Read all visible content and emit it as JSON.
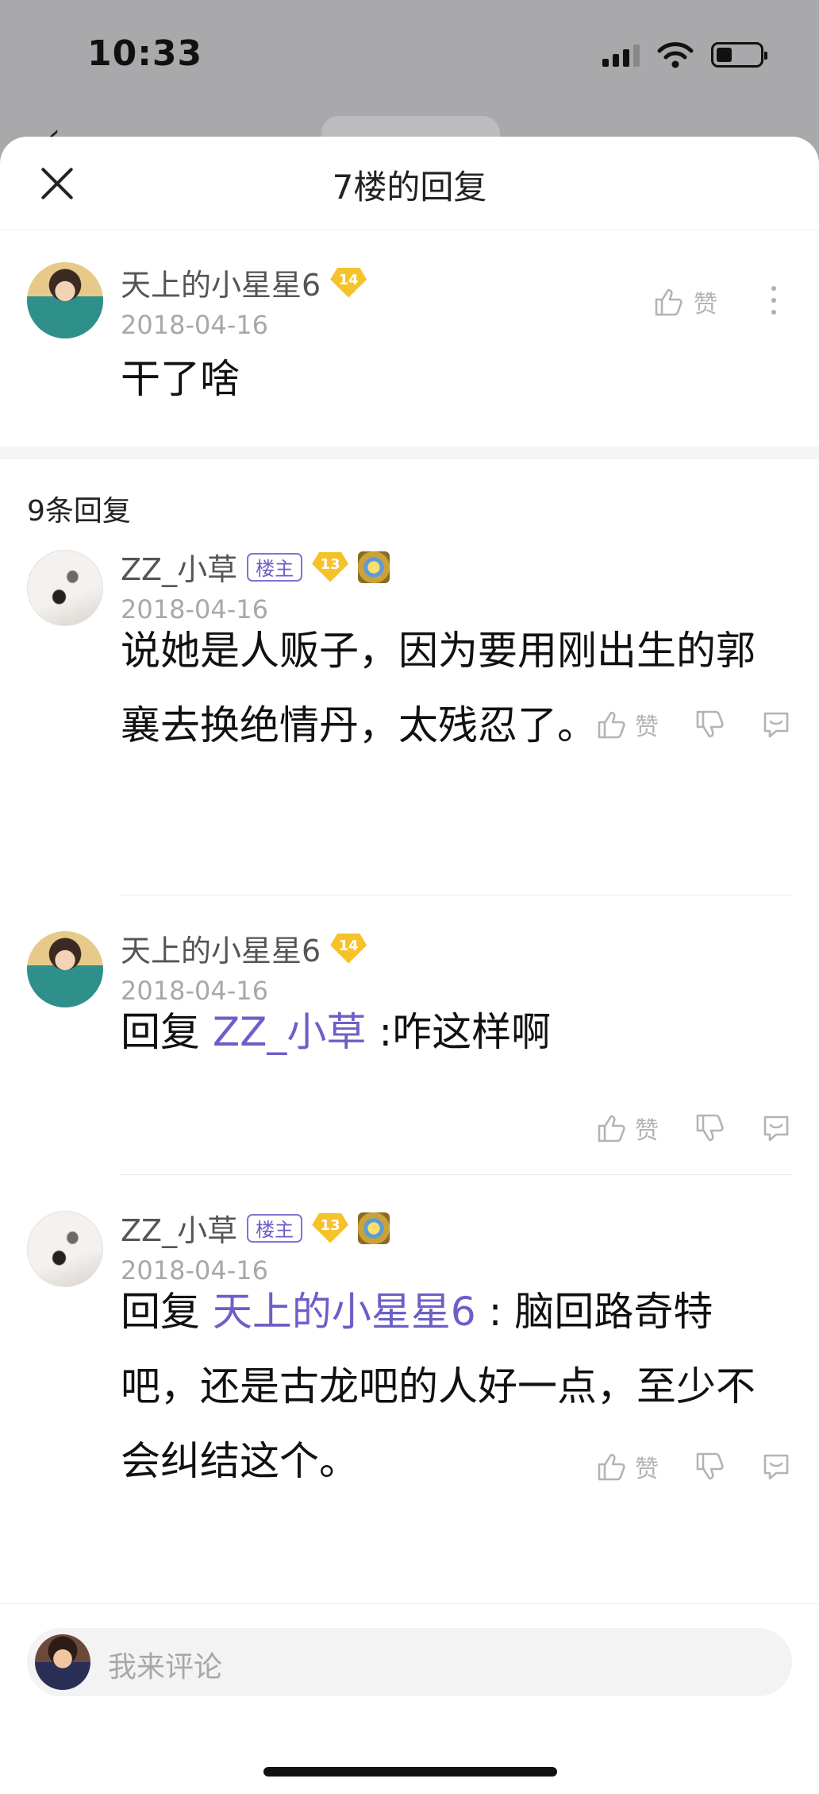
{
  "status_bar": {
    "time": "10:33"
  },
  "sheet": {
    "title": "7楼的回复"
  },
  "main_post": {
    "username": "天上的小星星6",
    "level": "14",
    "date": "2018-04-16",
    "like_label": "赞",
    "content": "干了啥"
  },
  "replies_header": "9条回复",
  "replies": [
    {
      "username": "ZZ_小草",
      "host_badge": "楼主",
      "level": "13",
      "date": "2018-04-16",
      "content": "说她是人贩子，因为要用刚出生的郭襄去换绝情丹，太残忍了。",
      "like_label": "赞"
    },
    {
      "username": "天上的小星星6",
      "level": "14",
      "date": "2018-04-16",
      "reply_prefix": "回复",
      "reply_to": "ZZ_小草",
      "content": ":咋这样啊",
      "like_label": "赞"
    },
    {
      "username": "ZZ_小草",
      "host_badge": "楼主",
      "level": "13",
      "date": "2018-04-16",
      "reply_prefix": "回复",
      "reply_to": "天上的小星星6",
      "content": ": 脑回路奇特吧，还是古龙吧的人好一点，至少不会纠结这个。",
      "like_label": "赞"
    }
  ],
  "comment_input": {
    "placeholder": "我来评论"
  },
  "colors": {
    "link": "#6c5fc7",
    "level_badge": "#f6c22a",
    "sheet_bg": "#ffffff",
    "backdrop": "#a9a9ab"
  },
  "icons": [
    "close-icon",
    "thumbs-up-icon",
    "thumbs-down-icon",
    "comment-icon",
    "more-icon",
    "signal-icon",
    "wifi-icon",
    "battery-icon"
  ]
}
